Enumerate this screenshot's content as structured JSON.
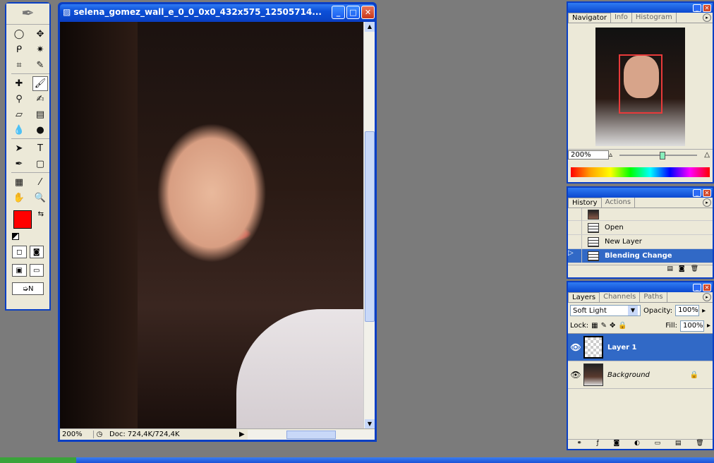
{
  "document": {
    "title": "selena_gomez_wall_e_0_0_0x0_432x575_12505714...",
    "zoom": "200%",
    "doc_size": "Doc: 724,4K/724,4K"
  },
  "toolbox": {
    "tools": [
      "marquee-icon",
      "move-icon",
      "lasso-icon",
      "magic-wand-icon",
      "crop-icon",
      "slice-icon",
      "healing-icon",
      "brush-icon",
      "stamp-icon",
      "history-brush-icon",
      "eraser-icon",
      "gradient-icon",
      "blur-icon",
      "dodge-icon",
      "path-select-icon",
      "type-icon",
      "pen-icon",
      "shape-icon",
      "notes-icon",
      "eyedropper-icon",
      "hand-icon",
      "zoom-icon"
    ],
    "type_glyph": "T",
    "foreground_color": "#ff0000",
    "background_color": "#ffffff"
  },
  "navigator": {
    "tabs": [
      "Navigator",
      "Info",
      "Histogram"
    ],
    "zoom": "200%"
  },
  "history": {
    "tabs": [
      "History",
      "Actions"
    ],
    "items": [
      "Open",
      "New Layer",
      "Blending Change"
    ],
    "selected": "Blending Change"
  },
  "layers": {
    "tabs": [
      "Layers",
      "Channels",
      "Paths"
    ],
    "blend_mode": "Soft Light",
    "opacity_label": "Opacity:",
    "opacity": "100%",
    "lock_label": "Lock:",
    "fill_label": "Fill:",
    "fill": "100%",
    "items": [
      {
        "name": "Layer 1",
        "selected": true
      },
      {
        "name": "Background",
        "selected": false
      }
    ]
  }
}
